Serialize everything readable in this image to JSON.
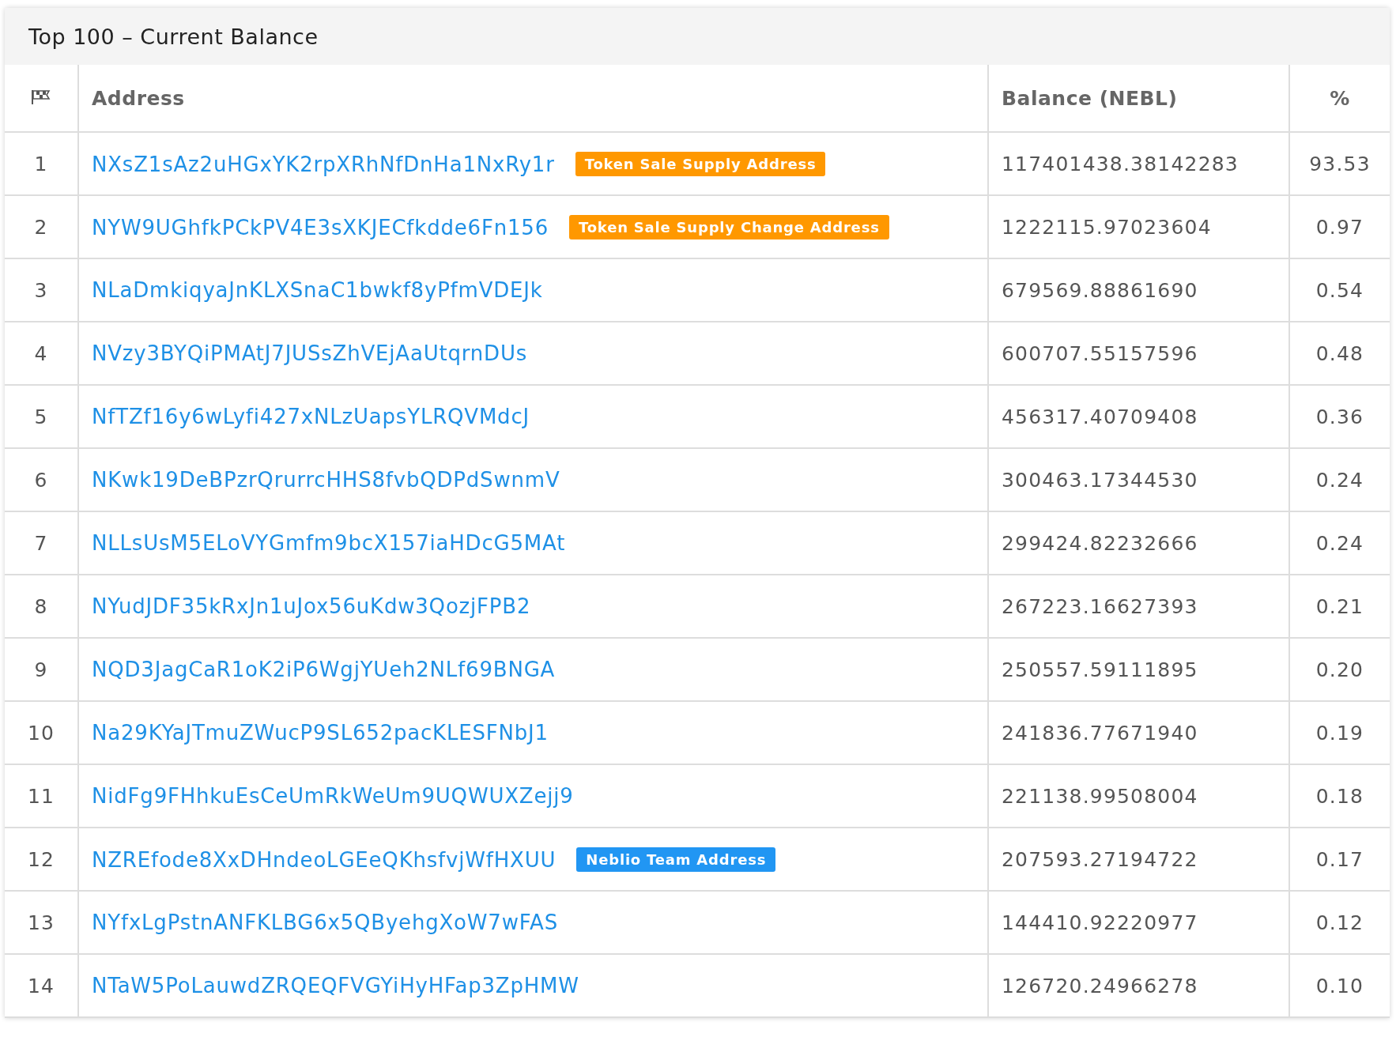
{
  "panel": {
    "title": "Top 100 – Current Balance"
  },
  "table": {
    "columns": [
      {
        "kind": "icon"
      },
      {
        "kind": "text",
        "label": "Address"
      },
      {
        "kind": "text",
        "label": "Balance (NEBL)"
      },
      {
        "kind": "text",
        "label": "%"
      }
    ],
    "rows": [
      {
        "rank": "1",
        "address": "NXsZ1sAz2uHGxYK2rpXRhNfDnHa1NxRy1r",
        "badge": {
          "label": "Token Sale Supply Address",
          "color": "#ff9800"
        },
        "balance": "117401438.38142283",
        "percent": "93.53"
      },
      {
        "rank": "2",
        "address": "NYW9UGhfkPCkPV4E3sXKJECfkdde6Fn156",
        "badge": {
          "label": "Token Sale Supply Change Address",
          "color": "#ff9800"
        },
        "balance": "1222115.97023604",
        "percent": "0.97"
      },
      {
        "rank": "3",
        "address": "NLaDmkiqyaJnKLXSnaC1bwkf8yPfmVDEJk",
        "balance": "679569.88861690",
        "percent": "0.54"
      },
      {
        "rank": "4",
        "address": "NVzy3BYQiPMAtJ7JUSsZhVEjAaUtqrnDUs",
        "balance": "600707.55157596",
        "percent": "0.48"
      },
      {
        "rank": "5",
        "address": "NfTZf16y6wLyfi427xNLzUapsYLRQVMdcJ",
        "balance": "456317.40709408",
        "percent": "0.36"
      },
      {
        "rank": "6",
        "address": "NKwk19DeBPzrQrurrcHHS8fvbQDPdSwnmV",
        "balance": "300463.17344530",
        "percent": "0.24"
      },
      {
        "rank": "7",
        "address": "NLLsUsM5ELoVYGmfm9bcX157iaHDcG5MAt",
        "balance": "299424.82232666",
        "percent": "0.24"
      },
      {
        "rank": "8",
        "address": "NYudJDF35kRxJn1uJox56uKdw3QozjFPB2",
        "balance": "267223.16627393",
        "percent": "0.21"
      },
      {
        "rank": "9",
        "address": "NQD3JagCaR1oK2iP6WgjYUeh2NLf69BNGA",
        "balance": "250557.59111895",
        "percent": "0.20"
      },
      {
        "rank": "10",
        "address": "Na29KYaJTmuZWucP9SL652pacKLESFNbJ1",
        "balance": "241836.77671940",
        "percent": "0.19"
      },
      {
        "rank": "11",
        "address": "NidFg9FHhkuEsCeUmRkWeUm9UQWUXZejj9",
        "balance": "221138.99508004",
        "percent": "0.18"
      },
      {
        "rank": "12",
        "address": "NZREfode8XxDHndeoLGEeQKhsfvjWfHXUU",
        "badge": {
          "label": "Neblio Team Address",
          "color": "#2196f3"
        },
        "balance": "207593.27194722",
        "percent": "0.17"
      },
      {
        "rank": "13",
        "address": "NYfxLgPstnANFKLBG6x5QByehgXoW7wFAS",
        "balance": "144410.92220977",
        "percent": "0.12"
      },
      {
        "rank": "14",
        "address": "NTaW5PoLauwdZRQEQFVGYiHyHFap3ZpHMW",
        "balance": "126720.24966278",
        "percent": "0.10"
      }
    ]
  }
}
